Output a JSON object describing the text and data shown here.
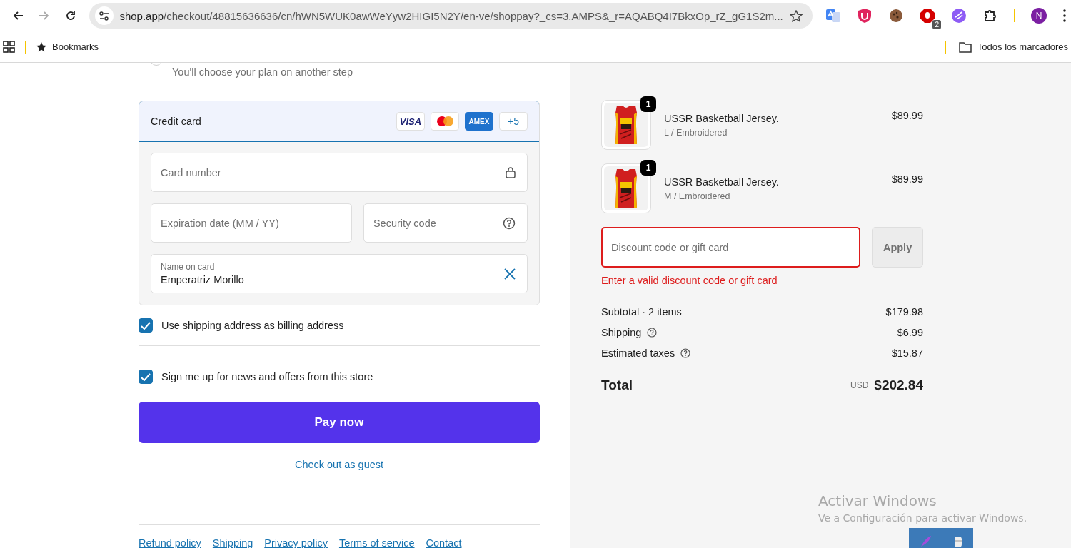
{
  "browser": {
    "url_host": "shop.app",
    "url_path": "/checkout/48815636636/cn/hWN5WUK0awWeYyw2HIGI5N2Y/en-ve/shoppay?_cs=3.AMPS&_r=AQABQ4I7BkxOp_rZ_gG1S2m...",
    "extension_badge": "2",
    "profile_initial": "N",
    "bookmarks": [
      "Bookmarks"
    ],
    "all_bookmarks": "Todos los marcadores"
  },
  "checkout": {
    "plan_hint": "You'll choose your plan on another step",
    "plan_selected": false,
    "payment": {
      "title": "Credit card",
      "selected": true,
      "brands": [
        {
          "kind": "visa",
          "label": "VISA"
        },
        {
          "kind": "mastercard"
        },
        {
          "kind": "amex",
          "label": "AMEX"
        },
        {
          "kind": "more",
          "label": "+5"
        }
      ],
      "card_number": {
        "placeholder": "Card number"
      },
      "expiration": {
        "placeholder": "Expiration date (MM / YY)"
      },
      "security_code": {
        "placeholder": "Security code"
      },
      "name_on_card": {
        "label": "Name on card",
        "value": "Emperatriz Morillo"
      }
    },
    "options": [
      {
        "label": "Use shipping address as billing address",
        "checked": true
      },
      {
        "label": "Sign me up for news and offers from this store",
        "checked": true
      }
    ],
    "pay_button": "Pay now",
    "guest_link": "Check out as guest",
    "footer_links": [
      "Refund policy",
      "Shipping",
      "Privacy policy",
      "Terms of service",
      "Contact"
    ]
  },
  "summary": {
    "items": [
      {
        "name": "USSR Basketball Jersey.",
        "variant": "L / Embroidered",
        "price": "$89.99",
        "quantity": "1"
      },
      {
        "name": "USSR Basketball Jersey.",
        "variant": "M / Embroidered",
        "price": "$89.99",
        "quantity": "1"
      }
    ],
    "discount": {
      "placeholder": "Discount code or gift card",
      "error": "Enter a valid discount code or gift card",
      "apply": "Apply",
      "invalid": true
    },
    "lines": [
      {
        "label": "Subtotal · 2 items",
        "value": "$179.98",
        "info": false
      },
      {
        "label": "Shipping",
        "value": "$6.99",
        "info": true
      },
      {
        "label": "Estimated taxes",
        "value": "$15.87",
        "info": true
      }
    ],
    "total": {
      "label": "Total",
      "currency": "USD",
      "amount": "$202.84"
    }
  },
  "os_notice": {
    "title": "Activar Windows",
    "subtitle": "Ve a Configuración para activar Windows."
  }
}
